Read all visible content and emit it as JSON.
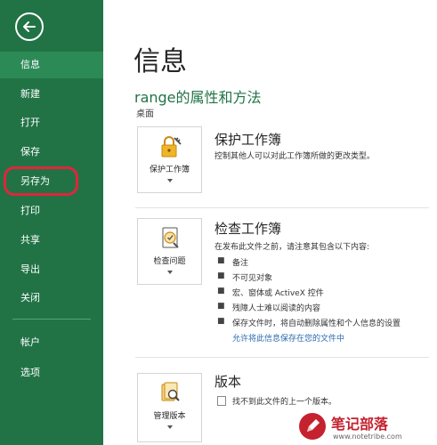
{
  "sidebar": {
    "items": [
      {
        "label": "信息"
      },
      {
        "label": "新建"
      },
      {
        "label": "打开"
      },
      {
        "label": "保存"
      },
      {
        "label": "另存为"
      },
      {
        "label": "打印"
      },
      {
        "label": "共享"
      },
      {
        "label": "导出"
      },
      {
        "label": "关闭"
      },
      {
        "label": "帐户"
      },
      {
        "label": "选项"
      }
    ],
    "active": "信息"
  },
  "main": {
    "title": "信息",
    "subtitle": "range的属性和方法",
    "location": "桌面",
    "protect": {
      "button_label": "保护工作簿",
      "title": "保护工作簿",
      "description": "控制其他人可以对此工作簿所做的更改类型。"
    },
    "inspect": {
      "button_label": "检查问题",
      "title": "检查工作簿",
      "description": "在发布此文件之前，请注意其包含以下内容:",
      "bullets": [
        "备注",
        "不可见对象",
        "宏、窗体或 ActiveX 控件",
        "残障人士难以阅读的内容",
        "保存文件时，将自动删除属性和个人信息的设置"
      ],
      "link": "允许将此信息保存在您的文件中"
    },
    "versions": {
      "button_label": "管理版本",
      "title": "版本",
      "description": "找不到此文件的上一个版本。"
    }
  },
  "watermark": {
    "title": "笔记部落",
    "url": "www.notetribe.com"
  },
  "colors": {
    "sidebar": "#217346",
    "active": "#2c8a57",
    "link": "#2b6ab0",
    "annotation": "#e0263a"
  }
}
